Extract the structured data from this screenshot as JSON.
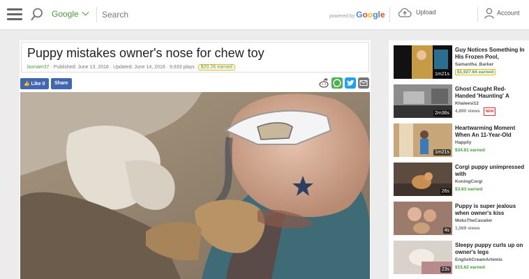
{
  "header": {
    "search_engine": "Google",
    "search_placeholder": "Search",
    "powered_by": "powered by",
    "powered_brand": "Google",
    "upload_label": "Upload",
    "account_label": "Account"
  },
  "video": {
    "title": "Puppy mistakes owner's nose for chew toy",
    "author": "burnam37",
    "published": "Published: June 13, 2018",
    "updated": "Updated: June 14, 2018",
    "plays": "9,833 plays",
    "earned": "$20.26 earned",
    "like_label": "Like 0",
    "share_label": "Share"
  },
  "sidebar": {
    "items": [
      {
        "title": "Guy Notices Something In His Frozen Pool,",
        "author": "Samantha_Barker",
        "stat": "",
        "earned": "$1,927.64 earned",
        "duration": "1m21s",
        "is_new": false,
        "new_label": ""
      },
      {
        "title": "Ghost Caught Red-Handed 'Haunting' A",
        "author": "Khaleesi12",
        "stat": "4,890 views",
        "earned": "",
        "duration": "2m36s",
        "is_new": true,
        "new_label": "NEW"
      },
      {
        "title": "Heartwarming Moment When An 11-Year-Old",
        "author": "Happily",
        "stat": "",
        "earned": "$34.81 earned",
        "duration": "1m21s",
        "is_new": false,
        "new_label": ""
      },
      {
        "title": "Corgi puppy unimpressed with",
        "author": "KoningCorgi",
        "stat": "",
        "earned": "$3.83 earned",
        "duration": "26s",
        "is_new": false,
        "new_label": ""
      },
      {
        "title": "Puppy is super jealous when owner's kiss",
        "author": "MoksTheCavalier",
        "stat": "1,569 views",
        "earned": "",
        "duration": "4s",
        "is_new": false,
        "new_label": ""
      },
      {
        "title": "Sleepy puppy curls up on owner's legs",
        "author": "EnglishCreamArtemis",
        "stat": "",
        "earned": "$15.62 earned",
        "duration": "23s",
        "is_new": false,
        "new_label": ""
      }
    ]
  },
  "colors": {
    "brand_green": "#4b9b3a",
    "facebook_blue": "#4267b2",
    "earned_highlight": "#f0b400"
  }
}
